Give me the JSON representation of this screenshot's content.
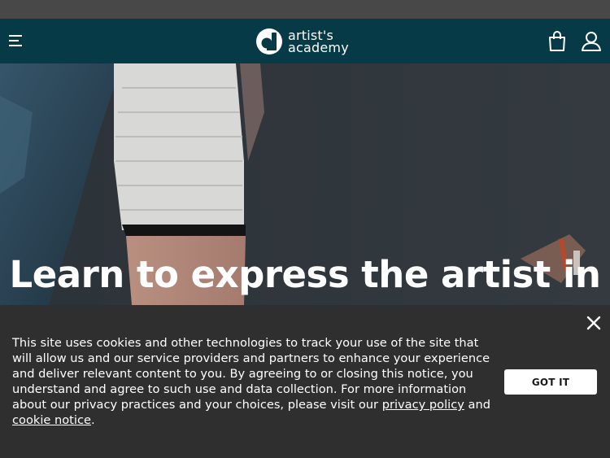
{
  "header": {
    "menu_icon": "hamburger-icon",
    "logo_line1": "artist's",
    "logo_line2": "academy",
    "cart_icon": "shopping-bag-icon",
    "account_icon": "user-icon",
    "background": "#063a47"
  },
  "hero": {
    "title": "Learn to express the artist in you"
  },
  "cookie_banner": {
    "message": "This site uses cookies and other technologies to track your use of the site that will allow us and our service providers and partners to enhance your experience and deliver relevant content to you. By agreeing to or closing this notice, you understand and agree to such use and data collection. For more information about our privacy practices and your choices, please visit our",
    "privacy_link": "privacy policy",
    "conjunction": "and",
    "cookie_link": "cookie notice",
    "end_punct": ".",
    "accept_label": "GOT IT",
    "close_icon": "close-icon",
    "background": "#2f2f2f"
  }
}
